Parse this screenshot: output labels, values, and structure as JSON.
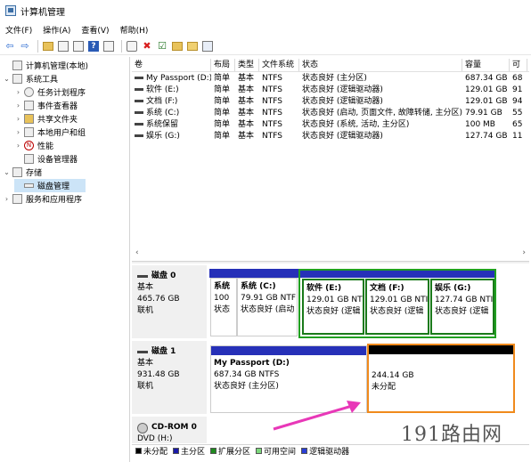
{
  "window": {
    "title": "计算机管理"
  },
  "menu": [
    "文件(F)",
    "操作(A)",
    "查看(V)",
    "帮助(H)"
  ],
  "toolbar": {
    "icons": [
      "back-arrow-icon",
      "forward-arrow-icon",
      "up-folder-icon",
      "show-tree-icon",
      "help-icon",
      "properties-icon",
      "connect-icon",
      "delete-icon",
      "check-icon",
      "folder-icon",
      "folder-open-icon",
      "list-view-icon"
    ],
    "back": "⇦",
    "forward": "⇨",
    "help": "?",
    "delete": "✖",
    "check": "☑"
  },
  "tree": {
    "root": "计算机管理(本地)",
    "system_tools": "系统工具",
    "task_scheduler": "任务计划程序",
    "event_viewer": "事件查看器",
    "shared_folders": "共享文件夹",
    "local_users": "本地用户和组",
    "performance": "性能",
    "device_manager": "设备管理器",
    "storage": "存储",
    "disk_management": "磁盘管理",
    "services": "服务和应用程序"
  },
  "volume_table": {
    "headers": [
      "卷",
      "布局",
      "类型",
      "文件系统",
      "状态",
      "容量",
      "可"
    ],
    "rows": [
      [
        "My Passport (D:)",
        "简单",
        "基本",
        "NTFS",
        "状态良好 (主分区)",
        "687.34 GB",
        "68"
      ],
      [
        "软件 (E:)",
        "简单",
        "基本",
        "NTFS",
        "状态良好 (逻辑驱动器)",
        "129.01 GB",
        "91"
      ],
      [
        "文档 (F:)",
        "简单",
        "基本",
        "NTFS",
        "状态良好 (逻辑驱动器)",
        "129.01 GB",
        "94"
      ],
      [
        "系统 (C:)",
        "简单",
        "基本",
        "NTFS",
        "状态良好 (启动, 页面文件, 故障转储, 主分区)",
        "79.91 GB",
        "55"
      ],
      [
        "系统保留",
        "简单",
        "基本",
        "NTFS",
        "状态良好 (系统, 活动, 主分区)",
        "100 MB",
        "65"
      ],
      [
        "娱乐 (G:)",
        "简单",
        "基本",
        "NTFS",
        "状态良好 (逻辑驱动器)",
        "127.74 GB",
        "11"
      ]
    ]
  },
  "disk0": {
    "name": "磁盘 0",
    "type": "基本",
    "size": "465.76 GB",
    "status": "联机",
    "parts": [
      {
        "name": "系统",
        "l2": "100",
        "l3": "状态"
      },
      {
        "name": "系统  (C:)",
        "l2": "79.91 GB NTF",
        "l3": "状态良好 (启动"
      },
      {
        "name": "软件  (E:)",
        "l2": "129.01 GB NT",
        "l3": "状态良好 (逻辑"
      },
      {
        "name": "文档  (F:)",
        "l2": "129.01 GB NTI",
        "l3": "状态良好 (逻辑"
      },
      {
        "name": "娱乐  (G:)",
        "l2": "127.74 GB NTI",
        "l3": "状态良好 (逻辑"
      }
    ]
  },
  "disk1": {
    "name": "磁盘 1",
    "type": "基本",
    "size": "931.48 GB",
    "status": "联机",
    "parts": [
      {
        "name": "My Passport  (D:)",
        "l2": "687.34 GB NTFS",
        "l3": "状态良好 (主分区)"
      },
      {
        "name": "",
        "l2": "244.14 GB",
        "l3": "未分配"
      }
    ]
  },
  "cdrom": {
    "name": "CD-ROM 0",
    "type": "DVD (H:)"
  },
  "legend": [
    {
      "label": "未分配",
      "color": "#000000"
    },
    {
      "label": "主分区",
      "color": "#1a1aa8"
    },
    {
      "label": "扩展分区",
      "color": "#1f8a1f"
    },
    {
      "label": "可用空间",
      "color": "#7cd87c"
    },
    {
      "label": "逻辑驱动器",
      "color": "#2a3fd6"
    }
  ],
  "scroll": {
    "left": "‹",
    "right": "›"
  },
  "colors": {
    "selection": "#cce4f7",
    "partition_bar": "#2630b8",
    "highlight_orange": "#f08a1c",
    "highlight_green": "#21a021",
    "arrow": "#e838b8"
  },
  "watermark": "191路由网"
}
